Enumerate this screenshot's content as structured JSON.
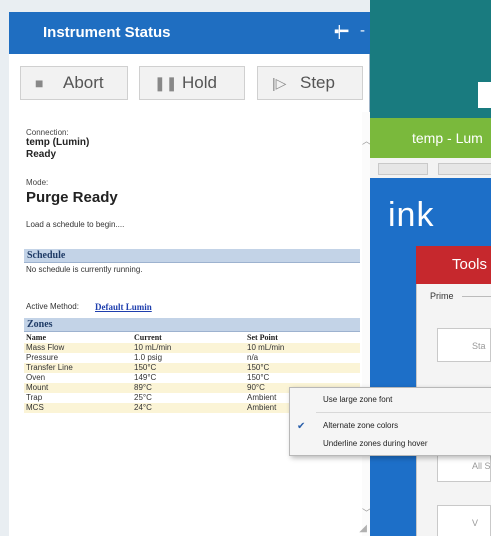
{
  "window": {
    "title": "Instrument Status",
    "pin_icon": "pin-icon",
    "minimize_label": "-"
  },
  "toolbar": {
    "abort_label": "Abort",
    "hold_label": "Hold",
    "step_label": "Step"
  },
  "status": {
    "connection_label": "Connection:",
    "connection_name": "temp (Lumin)",
    "connection_state": "Ready",
    "mode_label": "Mode:",
    "mode_value": "Purge Ready",
    "hint": "Load a schedule to begin...."
  },
  "schedule": {
    "header": "Schedule",
    "text": "No schedule is currently running.",
    "active_method_label": "Active Method:",
    "active_method_value": "Default Lumin"
  },
  "zones": {
    "header": "Zones",
    "columns": [
      "Name",
      "Current",
      "Set Point"
    ],
    "rows": [
      [
        "Mass Flow",
        "10 mL/min",
        "10 mL/min"
      ],
      [
        "Pressure",
        "1.0 psig",
        "n/a"
      ],
      [
        "Transfer Line",
        "150°C",
        "150°C"
      ],
      [
        "Oven",
        "149°C",
        "150°C"
      ],
      [
        "Mount",
        "89°C",
        "90°C"
      ],
      [
        "Trap",
        "25°C",
        "Ambient"
      ],
      [
        "MCS",
        "24°C",
        "Ambient"
      ]
    ]
  },
  "context_menu": {
    "items": [
      {
        "label": "Use large zone font",
        "checked": false
      },
      {
        "label": "Alternate zone colors",
        "checked": true
      },
      {
        "label": "Underline zones during hover",
        "checked": false
      }
    ]
  },
  "background_app": {
    "tile_label": "temp - Lum",
    "brand_text": "ink",
    "pane_title": "Tools",
    "prime_label": "Prime",
    "button_1": "Sta",
    "button_2": "All St",
    "button_3": "V"
  },
  "colors": {
    "titlebar": "#1f6ec1",
    "section_header": "#c3d3e7",
    "alt_row": "#fbf4d6",
    "link": "#1f3fae",
    "bg_teal": "#197b7f",
    "bg_green": "#7ab93c",
    "bg_blue": "#1d6fc8",
    "bg_red": "#c6282d"
  }
}
